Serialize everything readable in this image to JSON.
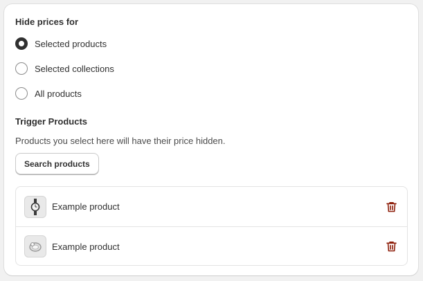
{
  "hide_prices": {
    "title": "Hide prices for",
    "options": [
      {
        "label": "Selected products",
        "checked": true
      },
      {
        "label": "Selected collections",
        "checked": false
      },
      {
        "label": "All products",
        "checked": false
      }
    ]
  },
  "trigger_products": {
    "title": "Trigger Products",
    "help_text": "Products you select here will have their price hidden.",
    "search_button_label": "Search products",
    "items": [
      {
        "name": "Example product",
        "thumbnail_icon": "watch-icon"
      },
      {
        "name": "Example product",
        "thumbnail_icon": "ring-icon"
      }
    ]
  },
  "colors": {
    "delete_icon": "#8e1f0b",
    "text": "#303030"
  }
}
